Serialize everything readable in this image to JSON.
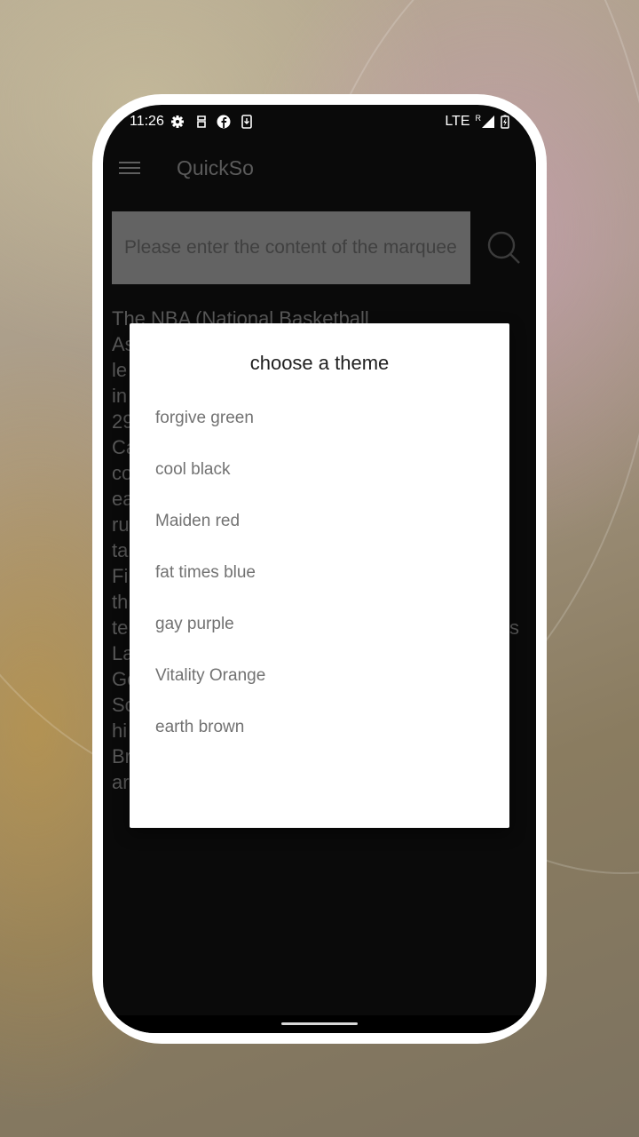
{
  "status_bar": {
    "time": "11:26",
    "left_icons": [
      "gear-icon",
      "notification-app-icon",
      "facebook-icon",
      "download-icon"
    ],
    "network": "LTE",
    "roaming": "R",
    "right_icons": [
      "signal-icon",
      "battery-charging-icon"
    ]
  },
  "app_bar": {
    "menu_icon": "hamburger-menu-icon",
    "title": "QuickSo"
  },
  "search": {
    "placeholder": "Please enter the content of the marquee",
    "button_icon": "search-icon"
  },
  "article": {
    "first_line": "The NBA (National Basketball",
    "visible_fragments": [
      "As",
      "le",
      "in",
      "29",
      "Ca",
      "co",
      "ea",
      "ru",
      "ta",
      "Fi",
      "th",
      "te",
      "La",
      "Go",
      "So",
      "hi",
      "Br",
      "ar"
    ],
    "right_fragment": "s"
  },
  "dialog": {
    "title": "choose a theme",
    "options": [
      {
        "label": "forgive green"
      },
      {
        "label": "cool black"
      },
      {
        "label": "Maiden red"
      },
      {
        "label": "fat times blue"
      },
      {
        "label": "gay purple"
      },
      {
        "label": "Vitality Orange"
      },
      {
        "label": "earth brown"
      }
    ]
  },
  "colors": {
    "screen_bg": "#0a0a0a",
    "dialog_bg": "#ffffff",
    "dialog_title": "#202020",
    "option_text": "#727272"
  }
}
